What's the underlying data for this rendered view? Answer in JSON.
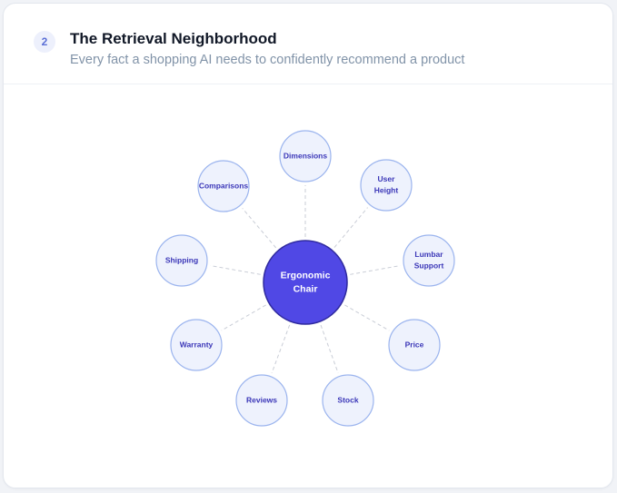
{
  "header": {
    "step": "2",
    "title": "The Retrieval Neighborhood",
    "subtitle": "Every fact a shopping AI needs to confidently recommend a product"
  },
  "diagram": {
    "center": {
      "label_lines": [
        "Ergonomic",
        "Chair"
      ],
      "fill": "#5048e5",
      "stroke": "#2f2a9e"
    },
    "node_style": {
      "fill": "#eef2fd",
      "stroke": "#9bb4ee",
      "text_color": "#3b37b8",
      "edge_color": "#c9cdd6"
    },
    "nodes": [
      {
        "id": "dimensions",
        "lines": [
          "Dimensions"
        ]
      },
      {
        "id": "user-height",
        "lines": [
          "User",
          "Height"
        ]
      },
      {
        "id": "lumbar-support",
        "lines": [
          "Lumbar",
          "Support"
        ]
      },
      {
        "id": "price",
        "lines": [
          "Price"
        ]
      },
      {
        "id": "stock",
        "lines": [
          "Stock"
        ]
      },
      {
        "id": "reviews",
        "lines": [
          "Reviews"
        ]
      },
      {
        "id": "warranty",
        "lines": [
          "Warranty"
        ]
      },
      {
        "id": "shipping",
        "lines": [
          "Shipping"
        ]
      },
      {
        "id": "comparisons",
        "lines": [
          "Comparisons"
        ]
      }
    ]
  }
}
